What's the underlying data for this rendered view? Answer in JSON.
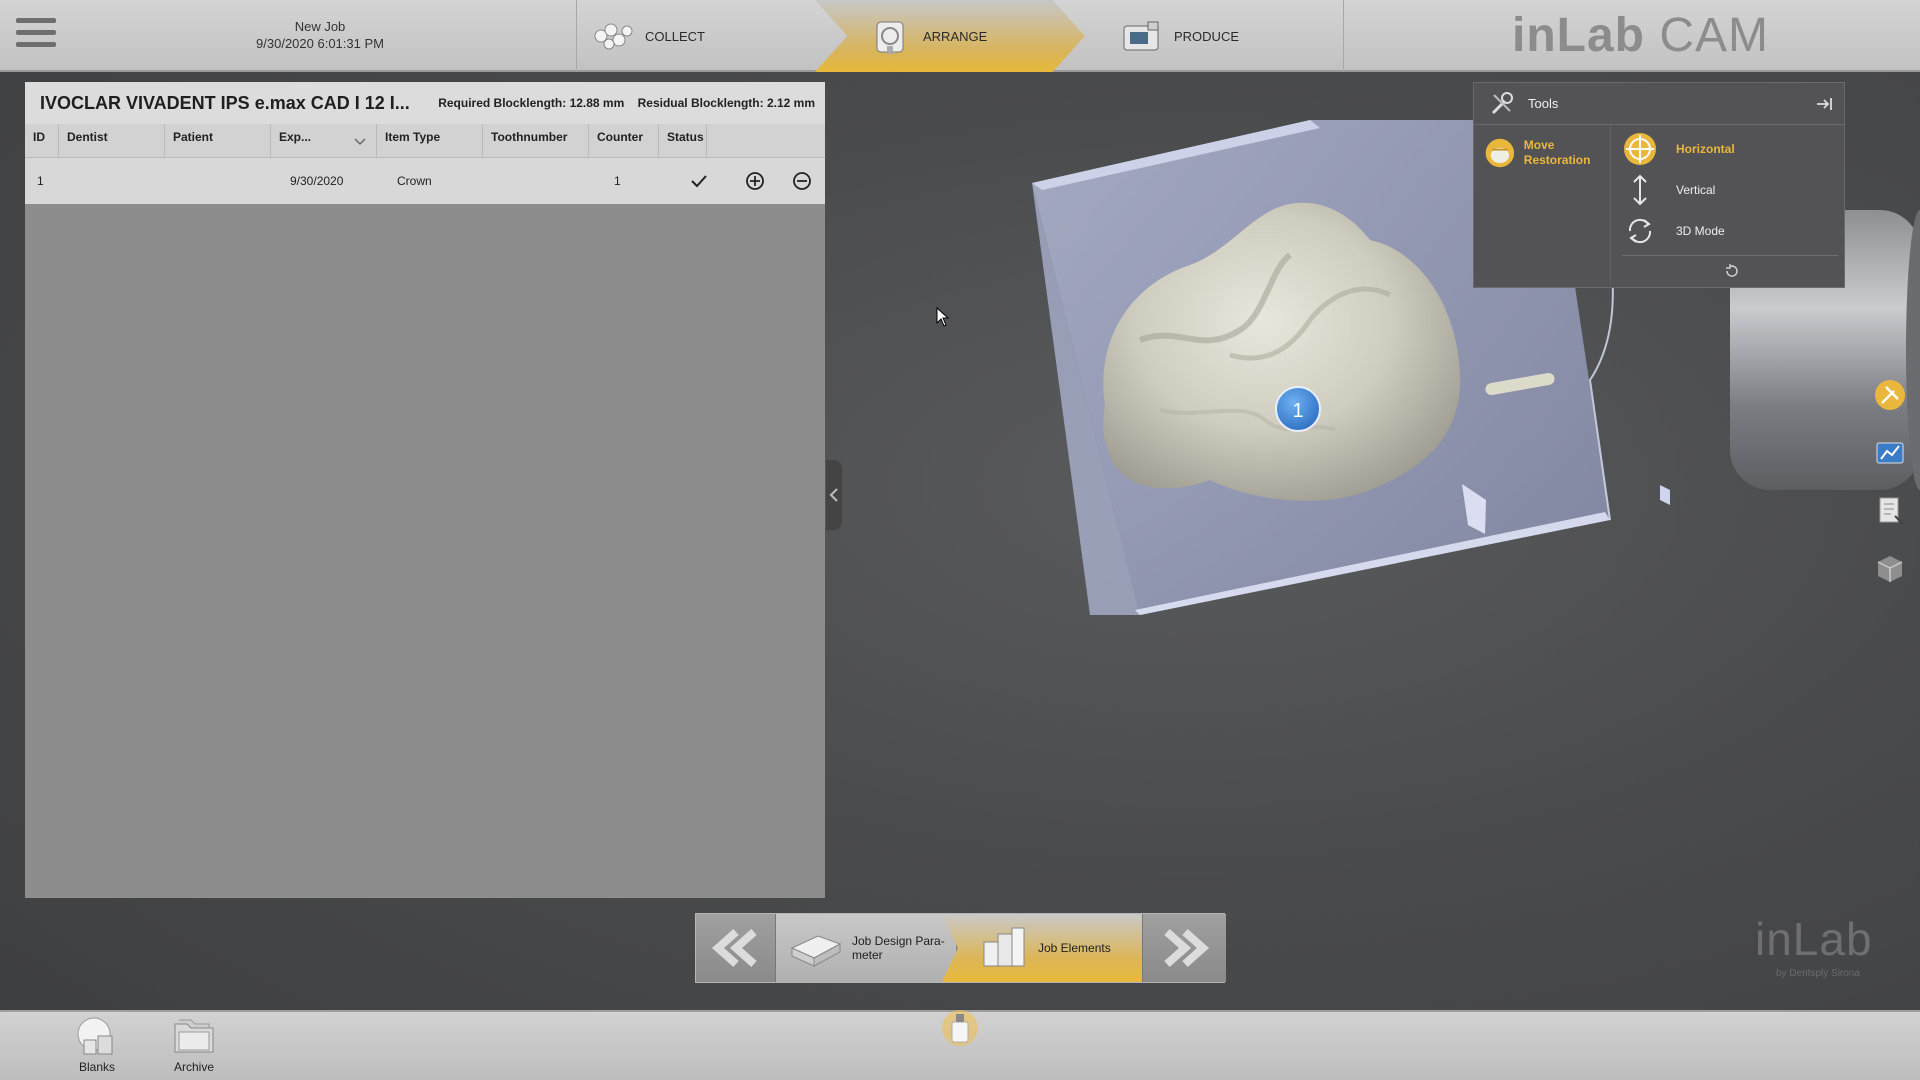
{
  "header": {
    "job_title": "New Job",
    "job_timestamp": "9/30/2020 6:01:31 PM",
    "tabs": [
      {
        "label": "COLLECT",
        "icon": "collect-icon",
        "active": false
      },
      {
        "label": "ARRANGE",
        "icon": "arrange-icon",
        "active": true
      },
      {
        "label": "PRODUCE",
        "icon": "produce-icon",
        "active": false
      }
    ],
    "brand_bold": "inLab",
    "brand_light": " CAM"
  },
  "job_table": {
    "material": "IVOCLAR VIVADENT IPS e.max CAD I 12 I...",
    "required_blocklength": "Required Blocklength: 12.88 mm",
    "residual_blocklength": "Residual Blocklength: 2.12 mm",
    "columns": [
      "ID",
      "Dentist",
      "Patient",
      "Exp...",
      "Item Type",
      "Toothnumber",
      "Counter",
      "Status"
    ],
    "rows": [
      {
        "id": "1",
        "dentist": "",
        "patient": "",
        "exp": "9/30/2020",
        "item_type": "Crown",
        "toothnumber": "",
        "counter": "1",
        "status": "done"
      }
    ]
  },
  "tools": {
    "title": "Tools",
    "move_restoration": "Move Restoration",
    "modes": [
      {
        "label": "Horizontal",
        "active": true
      },
      {
        "label": "Vertical",
        "active": false
      },
      {
        "label": "3D Mode",
        "active": false
      }
    ]
  },
  "viewport": {
    "restoration_marker": "1"
  },
  "watermark": {
    "main": "inLab",
    "byline": "by Dentsply Sirona"
  },
  "step_nav": {
    "job_design": "Job Design Para-meter",
    "job_elements": "Job Elements"
  },
  "bottombar": {
    "blanks": "Blanks",
    "archive": "Archive"
  },
  "colors": {
    "accent": "#e9b73c",
    "marker": "#3a86d8"
  }
}
